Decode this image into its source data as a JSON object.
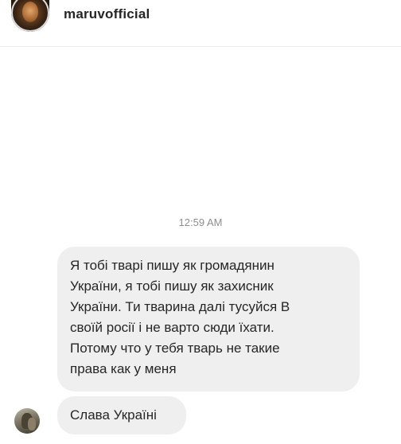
{
  "header": {
    "username": "maruvofficial",
    "avatar_icon": "profile-photo-avatar"
  },
  "conversation": {
    "timestamp": "12:59 AM",
    "messages": [
      {
        "sender": "other",
        "lines": [
          "Я тобі тварі пишу як громадянин",
          "України, я тобі пишу як захисник",
          "України. Ти тварина далі тусуйся В",
          "своїй росії і не варто сюди їхати.",
          "Потому что у тебя тварь не такие",
          "права как у меня"
        ]
      },
      {
        "sender": "other",
        "lines": [
          "Слава Україні"
        ]
      }
    ],
    "sender_avatar_icon": "profile-photo-avatar"
  },
  "colors": {
    "background": "#ffffff",
    "bubble": "#efefef",
    "text": "#262626",
    "timestamp": "#8e8e8e",
    "divider": "#ececec"
  }
}
